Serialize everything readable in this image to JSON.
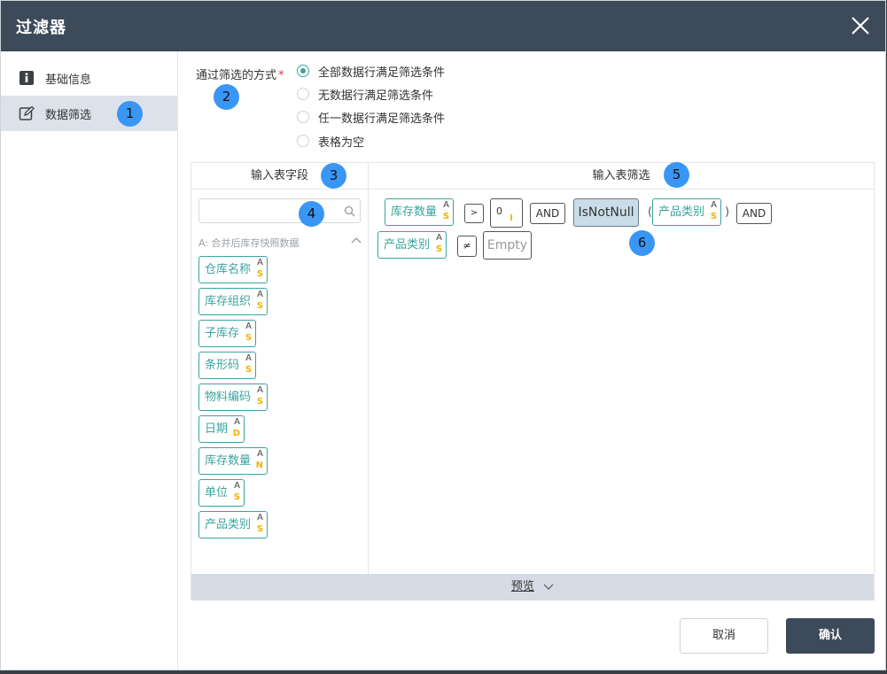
{
  "dialog": {
    "title": "过滤器"
  },
  "sidebar": {
    "items": [
      {
        "label": "基础信息",
        "icon": "info-icon"
      },
      {
        "label": "数据筛选",
        "icon": "edit-icon",
        "active": true
      }
    ]
  },
  "annotations": [
    "1",
    "2",
    "3",
    "4",
    "5",
    "6"
  ],
  "filter_mode": {
    "label": "通过筛选的方式",
    "required_mark": "*",
    "options": [
      {
        "label": "全部数据行满足筛选条件",
        "selected": true
      },
      {
        "label": "无数据行满足筛选条件",
        "selected": false
      },
      {
        "label": "任一数据行满足筛选条件",
        "selected": false
      },
      {
        "label": "表格为空",
        "selected": false
      }
    ]
  },
  "fields_panel": {
    "header": "输入表字段",
    "search_placeholder": "",
    "group_title": "A: 合并后库存快照数据",
    "fields": [
      {
        "name": "仓库名称",
        "source": "A",
        "type": "S"
      },
      {
        "name": "库存组织",
        "source": "A",
        "type": "S"
      },
      {
        "name": "子库存",
        "source": "A",
        "type": "S"
      },
      {
        "name": "条形码",
        "source": "A",
        "type": "S"
      },
      {
        "name": "物料编码",
        "source": "A",
        "type": "S"
      },
      {
        "name": "日期",
        "source": "A",
        "type": "D"
      },
      {
        "name": "库存数量",
        "source": "A",
        "type": "N"
      },
      {
        "name": "单位",
        "source": "A",
        "type": "S"
      },
      {
        "name": "产品类别",
        "source": "A",
        "type": "S"
      }
    ]
  },
  "filter_panel": {
    "header": "输入表筛选",
    "expr": {
      "field1": {
        "name": "库存数量",
        "source": "A",
        "type": "S"
      },
      "op_gt": ">",
      "value1": {
        "value": "0",
        "type": "I"
      },
      "and1": "AND",
      "isnotnull": "IsNotNull",
      "paren_open": "(",
      "field2": {
        "name": "产品类别",
        "source": "A",
        "type": "S"
      },
      "paren_close": ")",
      "and2": "AND",
      "field3": {
        "name": "产品类别",
        "source": "A",
        "type": "S"
      },
      "op_ne": "≠",
      "empty": "Empty"
    }
  },
  "preview": {
    "label": "预览"
  },
  "buttons": {
    "cancel": "取消",
    "ok": "确认"
  },
  "colors": {
    "header_bg": "#3d4a5a",
    "accent": "#3aa49f",
    "type_badge": "#f0b400",
    "annotation": "#3a96f5"
  }
}
